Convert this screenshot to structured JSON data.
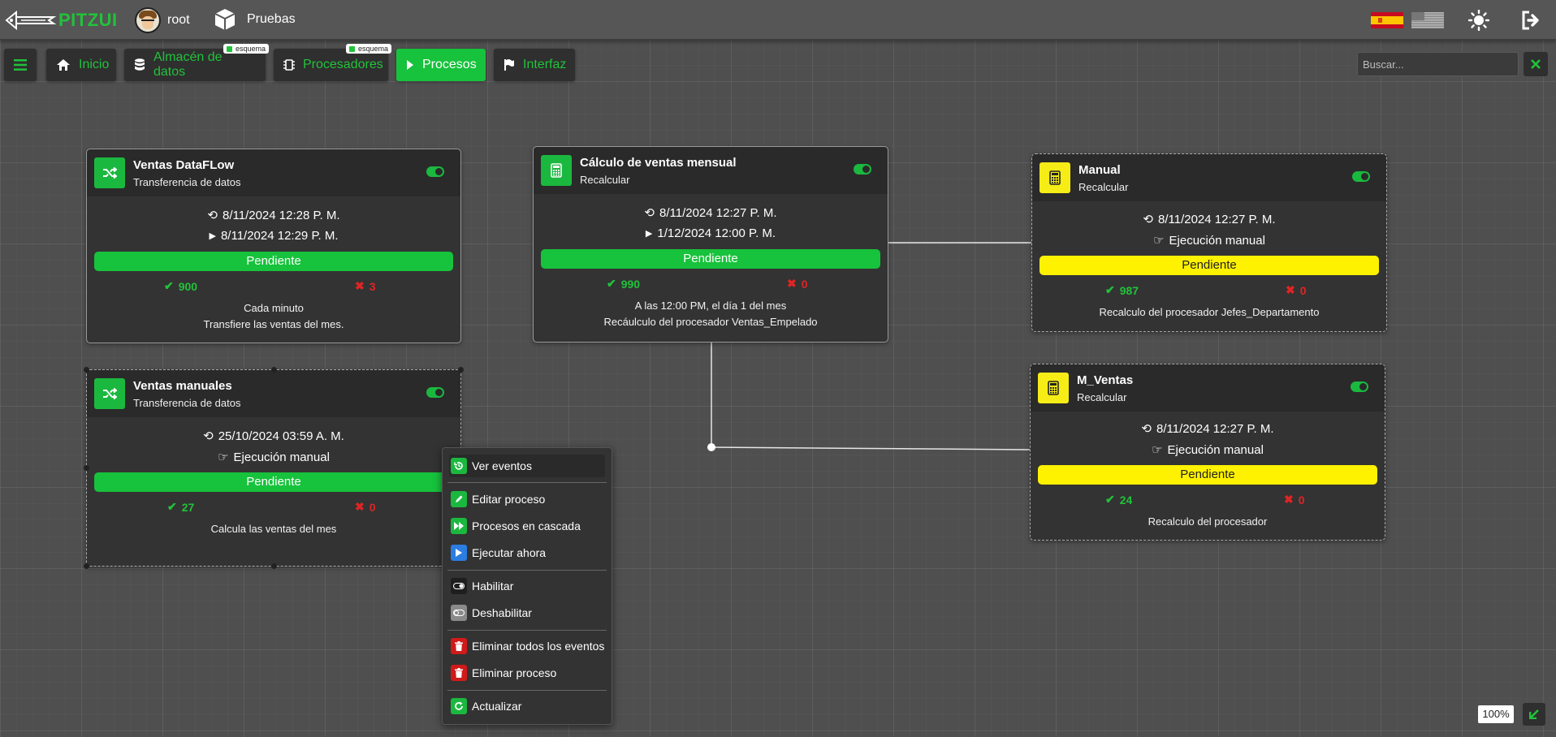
{
  "app": {
    "logo_text": "PITZUI",
    "user": "root",
    "project": "Pruebas"
  },
  "nav": {
    "home": "Inicio",
    "datastore": "Almacén de datos",
    "processors": "Procesadores",
    "processes": "Procesos",
    "interface": "Interfaz",
    "badge": "esquema"
  },
  "search": {
    "placeholder": "Buscar..."
  },
  "cards": [
    {
      "title": "Ventas DataFLow",
      "subtitle": "Transferencia de datos",
      "last": "8/11/2024 12:28 P. M.",
      "next": "8/11/2024 12:29 P. M.",
      "status": "Pendiente",
      "ok": "900",
      "err": "3",
      "schedule": "Cada minuto",
      "description": "Transfiere las ventas del mes."
    },
    {
      "title": "Cálculo de ventas mensual",
      "subtitle": "Recalcular",
      "last": "8/11/2024 12:27 P. M.",
      "next": "1/12/2024 12:00 P. M.",
      "status": "Pendiente",
      "ok": "990",
      "err": "0",
      "schedule": "A las 12:00 PM, el día 1 del mes",
      "description": "Recáulculo del procesador Ventas_Empelado"
    },
    {
      "title": "Manual",
      "subtitle": "Recalcular",
      "last": "8/11/2024 12:27 P. M.",
      "mode": "Ejecución manual",
      "status": "Pendiente",
      "ok": "987",
      "err": "0",
      "description": "Recalculo del procesador Jefes_Departamento"
    },
    {
      "title": "Ventas manuales",
      "subtitle": "Transferencia de datos",
      "last": "25/10/2024 03:59 A. M.",
      "mode": "Ejecución manual",
      "status": "Pendiente",
      "ok": "27",
      "err": "0",
      "description": "Calcula las ventas del mes"
    },
    {
      "title": "M_Ventas",
      "subtitle": "Recalcular",
      "last": "8/11/2024 12:27 P. M.",
      "mode": "Ejecución manual",
      "status": "Pendiente",
      "ok": "24",
      "err": "0",
      "description": "Recalculo del procesador"
    }
  ],
  "context_menu": {
    "view_events": "Ver eventos",
    "edit": "Editar proceso",
    "cascade": "Procesos en cascada",
    "run_now": "Ejecutar ahora",
    "enable": "Habilitar",
    "disable": "Deshabilitar",
    "delete_events": "Eliminar todos los eventos",
    "delete_process": "Eliminar proceso",
    "refresh": "Actualizar"
  },
  "zoom": "100%",
  "colors": {
    "accent": "#17c23c",
    "warning": "#fff200",
    "error": "#e02424",
    "panel": "#333333"
  }
}
